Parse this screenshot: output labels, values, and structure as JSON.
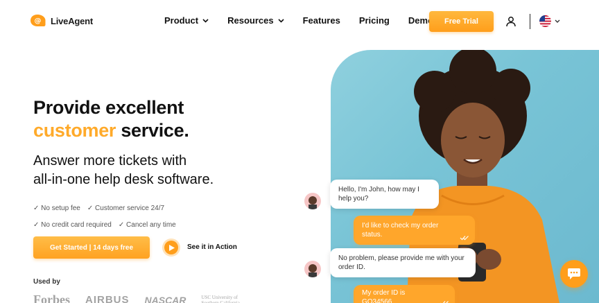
{
  "header": {
    "logo_text": "LiveAgent",
    "nav": [
      {
        "label": "Product",
        "has_dropdown": true
      },
      {
        "label": "Resources",
        "has_dropdown": true
      },
      {
        "label": "Features",
        "has_dropdown": false
      },
      {
        "label": "Pricing",
        "has_dropdown": false
      },
      {
        "label": "Demo",
        "has_dropdown": false
      }
    ],
    "cta_label": "Free Trial",
    "icons": [
      "user-icon",
      "us-flag-icon",
      "chevron-down-icon"
    ]
  },
  "hero": {
    "headline_line1": "Provide excellent",
    "headline_accent": "customer",
    "headline_rest": " service.",
    "subhead_line1": "Answer more tickets with",
    "subhead_line2": "all-in-one help desk software.",
    "features_row1": [
      "✓ No setup fee",
      "✓ Customer service 24/7"
    ],
    "features_row2": [
      "✓ No credit card required",
      "✓ Cancel any time"
    ],
    "primary_cta": "Get Started | 14 days free",
    "secondary_cta": "See it in Action",
    "used_by_label": "Used by",
    "brands": [
      "Forbes",
      "AIRBUS",
      "NASCAR",
      "USC University of Southern California"
    ]
  },
  "chat": {
    "messages": [
      {
        "from": "agent",
        "text": "Hello, I'm John, how may I help you?"
      },
      {
        "from": "customer",
        "text": "I'd like to check my order status."
      },
      {
        "from": "agent",
        "text": "No problem, please provide me with your order ID."
      },
      {
        "from": "customer",
        "text": "My order ID is GQ34566"
      }
    ]
  },
  "colors": {
    "accent": "#ffa62b",
    "hero_bg": "#79c4d6",
    "text": "#111111"
  }
}
